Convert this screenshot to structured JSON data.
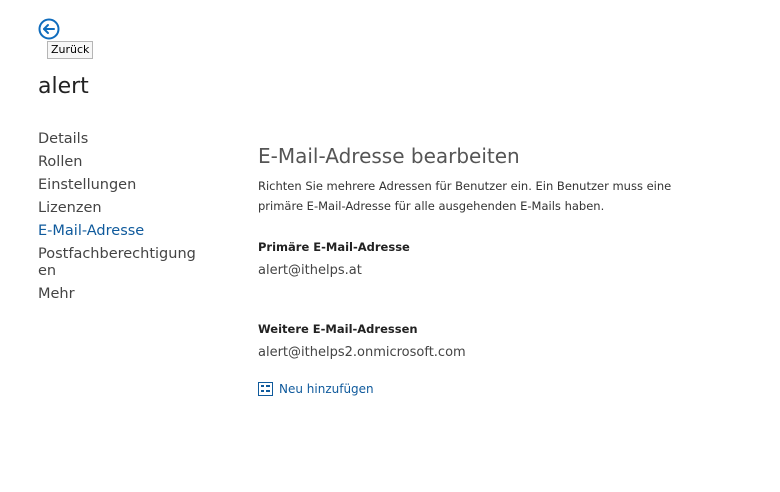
{
  "header": {
    "back_icon": "arrow-left-circle-icon",
    "back_tooltip": "Zurück",
    "title": "alert"
  },
  "sidebar": {
    "items": [
      {
        "label": "Details",
        "active": false
      },
      {
        "label": "Rollen",
        "active": false
      },
      {
        "label": "Einstellungen",
        "active": false
      },
      {
        "label": "Lizenzen",
        "active": false
      },
      {
        "label": "E-Mail-Adresse",
        "active": true
      },
      {
        "label": "Postfachberechtigungen",
        "active": false
      },
      {
        "label": "Mehr",
        "active": false
      }
    ]
  },
  "main": {
    "title": "E-Mail-Adresse bearbeiten",
    "description": "Richten Sie mehrere Adressen für Benutzer ein. Ein Benutzer muss eine primäre E-Mail-Adresse für alle ausgehenden E-Mails haben.",
    "primary_label": "Primäre E-Mail-Adresse",
    "primary_value": "alert@ithelps.at",
    "others_label": "Weitere E-Mail-Adressen",
    "others_values": [
      "alert@ithelps2.onmicrosoft.com"
    ],
    "add_link": {
      "label": "Neu hinzufügen",
      "icon": "add-item-icon"
    }
  },
  "colors": {
    "accent": "#0f5a9c",
    "back_icon": "#0f6cbd",
    "text": "#333333"
  }
}
